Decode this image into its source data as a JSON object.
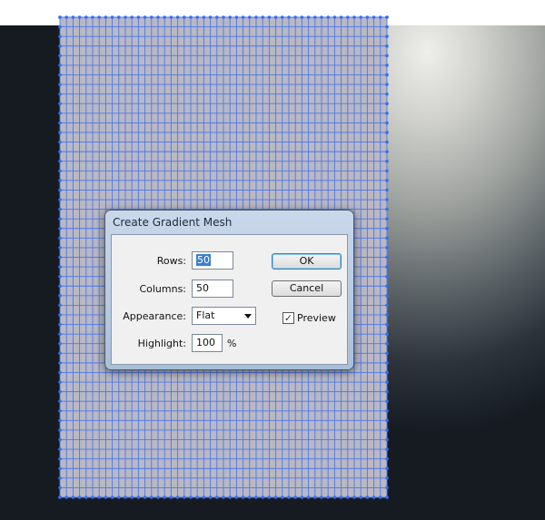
{
  "dialog": {
    "title": "Create Gradient Mesh",
    "rows": {
      "label": "Rows:",
      "value": "50"
    },
    "columns": {
      "label": "Columns:",
      "value": "50"
    },
    "appearance": {
      "label": "Appearance:",
      "value": "Flat"
    },
    "highlight": {
      "label": "Highlight:",
      "value": "100",
      "unit": "%"
    },
    "ok_label": "OK",
    "cancel_label": "Cancel",
    "preview": {
      "label": "Preview",
      "checked": true,
      "check_glyph": "✓"
    }
  },
  "mesh": {
    "rows": 50,
    "columns": 50,
    "fill_color": "#b9b8c4",
    "line_color": "#4d79e6",
    "point_color": "#3a6df0"
  },
  "colors": {
    "dialog_frame": "#b9cce2",
    "dialog_body": "#f0f0f0",
    "selection": "#3b7fd0"
  }
}
